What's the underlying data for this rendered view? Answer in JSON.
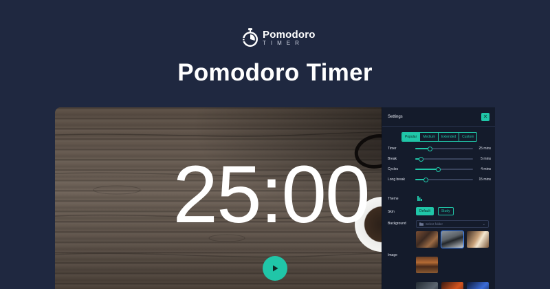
{
  "brand": {
    "name": "Pomodoro",
    "sub": "TIMER"
  },
  "page": {
    "title": "Pomodoro Timer"
  },
  "timer": {
    "display": "25:00"
  },
  "settings": {
    "title": "Settings",
    "close_symbol": "✕",
    "presets": [
      "Popular",
      "Medium",
      "Extended",
      "Custom"
    ],
    "active_preset": "Popular",
    "sliders": [
      {
        "label": "Timer",
        "value": "25 mins",
        "fraction": 0.25
      },
      {
        "label": "Break",
        "value": "5 mins",
        "fraction": 0.1
      },
      {
        "label": "Cycles",
        "value": "4 mins",
        "fraction": 0.4
      },
      {
        "label": "Long break",
        "value": "15 mins",
        "fraction": 0.18
      }
    ],
    "theme_label": "Theme",
    "skin_label": "Skin",
    "skins": [
      "Default",
      "Study"
    ],
    "active_skin": "Default",
    "background_label": "Background",
    "background_placeholder": "Select folder",
    "image_label": "Image"
  },
  "colors": {
    "accent": "#20c6a8",
    "page_bg": "#1f2840",
    "panel_bg": "#141b2b",
    "selected_outline": "#3b82f6"
  }
}
